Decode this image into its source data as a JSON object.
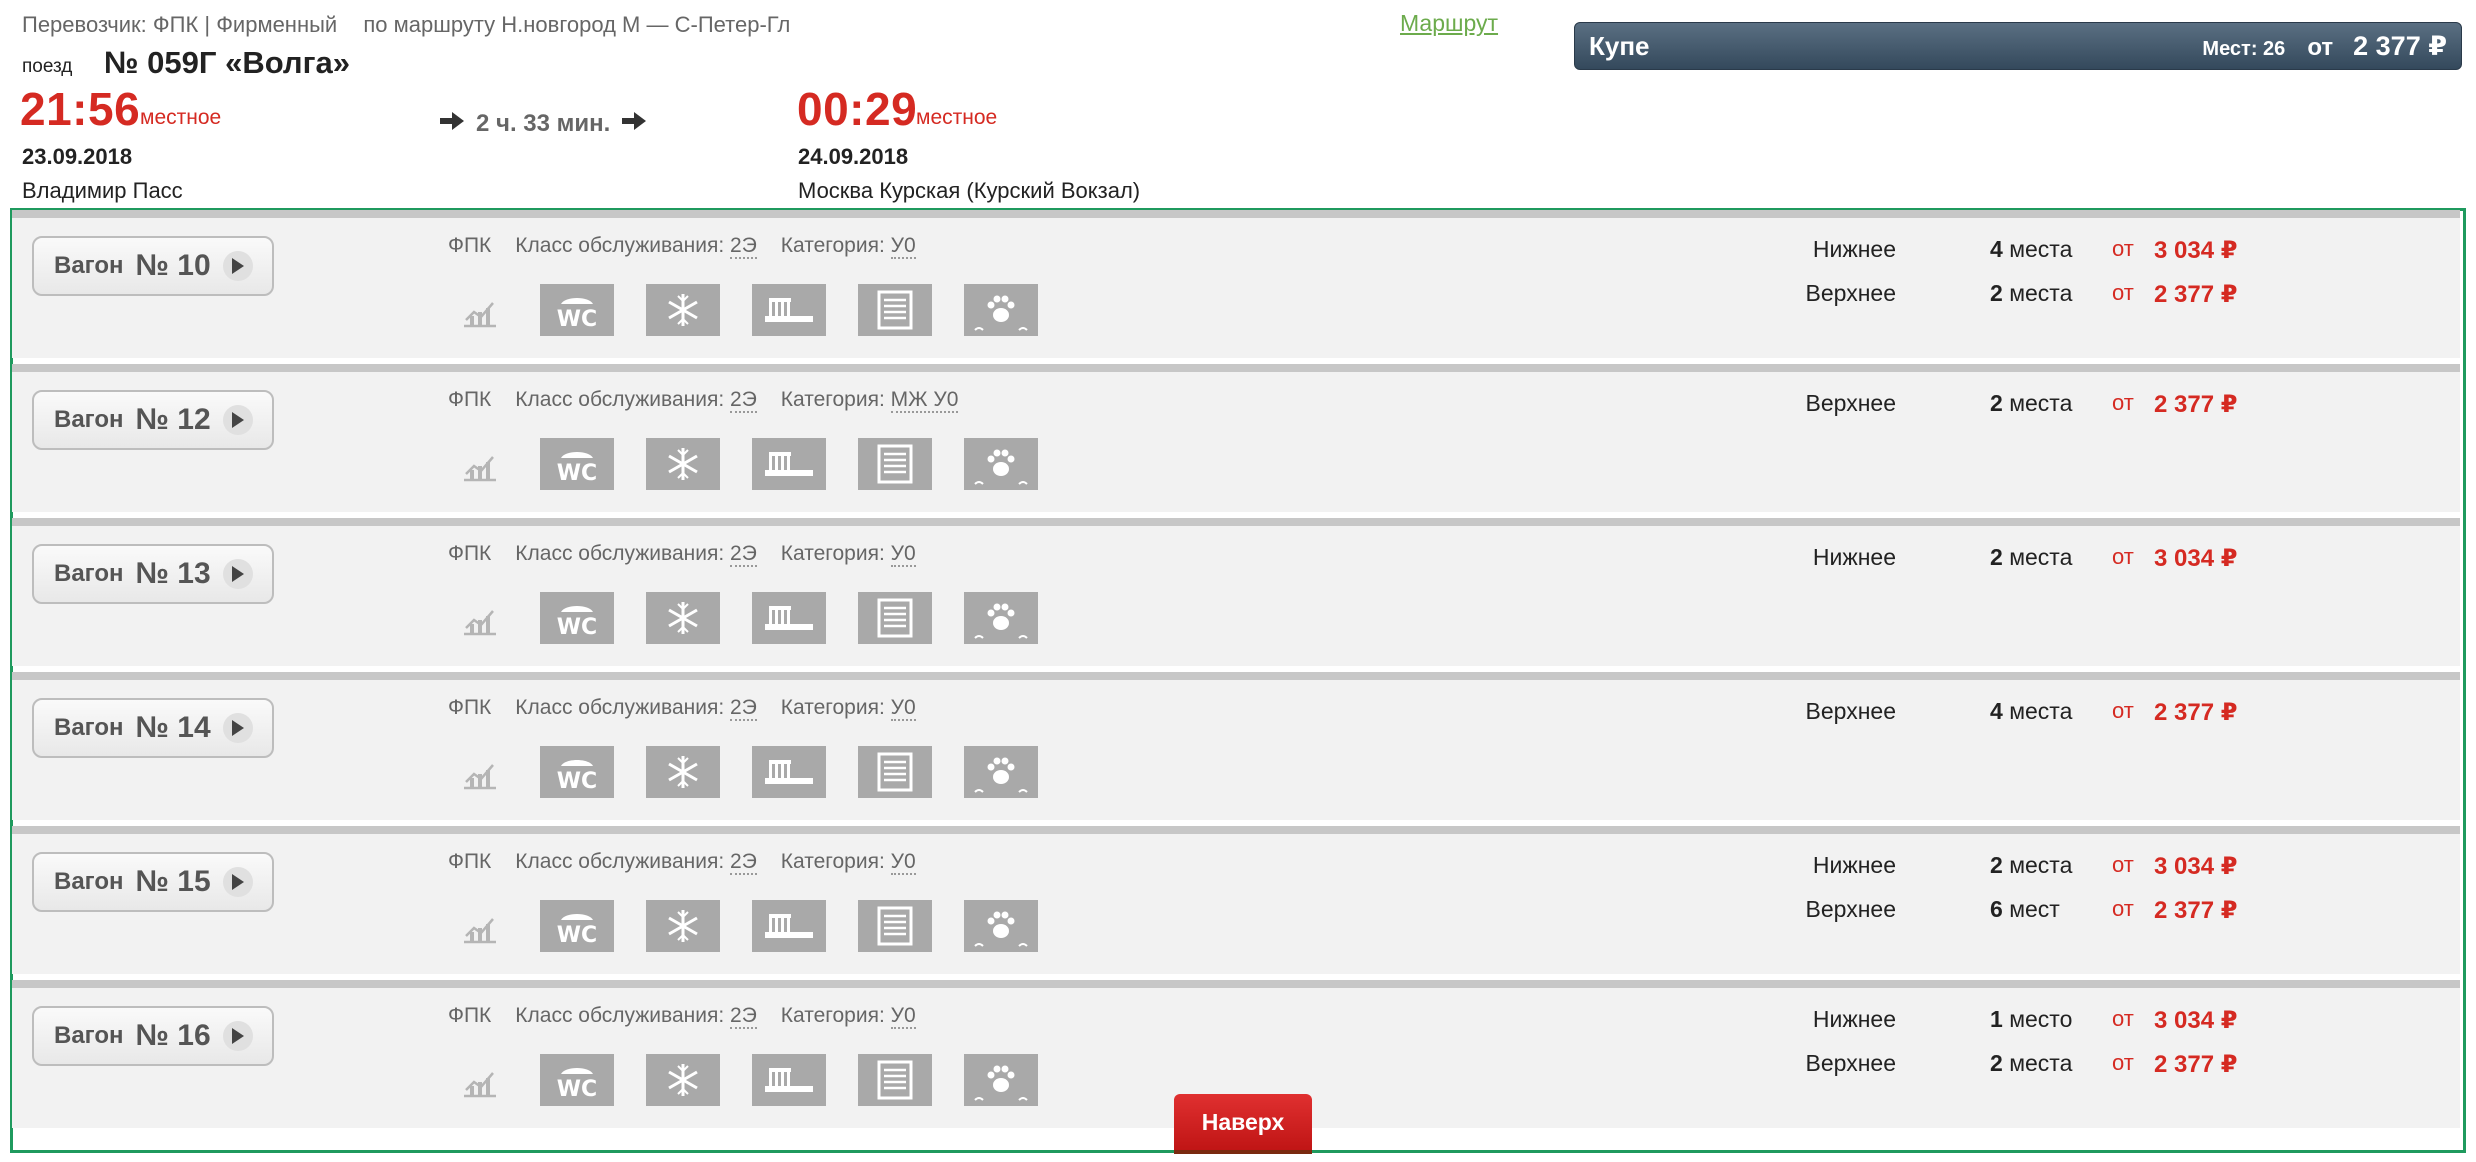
{
  "header": {
    "carrier_text": "Перевозчик: ФПК | Фирменный",
    "route_text": "по маршруту Н.новгород М — С-Петер-Гл",
    "route_link": "Маршрут",
    "train_word": "поезд",
    "train_number": "№ 059Г «Волга»",
    "departure": {
      "time": "21:56",
      "local": "местное",
      "date": "23.09.2018",
      "station": "Владимир Пасс"
    },
    "arrival": {
      "time": "00:29",
      "local": "местное",
      "date": "24.09.2018",
      "station": "Москва Курская (Курский Вокзал)"
    },
    "duration": "2 ч. 33 мин."
  },
  "class_badge": {
    "name": "Купе",
    "seats": "Мест: 26",
    "from": "от",
    "price": "2 377 ₽"
  },
  "colors": {
    "accent_red": "#d52a22",
    "panel_border": "#1f9a5e",
    "badge_bg": "#3f5366",
    "route_link": "#6cab4c"
  },
  "icon_names": [
    "chart-icon",
    "wc-icon",
    "snowflake-icon",
    "toothbrush-icon",
    "news-icon",
    "pet-icon"
  ],
  "wagons": [
    {
      "word": "Вагон",
      "number": "№ 10",
      "carrier": "ФПК",
      "class_label": "Класс обслуживания:",
      "class_value": "2Э",
      "category_label": "Категория:",
      "category_value": "У0",
      "seats": [
        {
          "type": "Нижнее",
          "count": "4",
          "unit": "места",
          "from": "от",
          "price": "3 034 ₽"
        },
        {
          "type": "Верхнее",
          "count": "2",
          "unit": "места",
          "from": "от",
          "price": "2 377 ₽"
        }
      ]
    },
    {
      "word": "Вагон",
      "number": "№ 12",
      "carrier": "ФПК",
      "class_label": "Класс обслуживания:",
      "class_value": "2Э",
      "category_label": "Категория:",
      "category_value": "МЖ У0",
      "seats": [
        {
          "type": "Верхнее",
          "count": "2",
          "unit": "места",
          "from": "от",
          "price": "2 377 ₽"
        }
      ]
    },
    {
      "word": "Вагон",
      "number": "№ 13",
      "carrier": "ФПК",
      "class_label": "Класс обслуживания:",
      "class_value": "2Э",
      "category_label": "Категория:",
      "category_value": "У0",
      "seats": [
        {
          "type": "Нижнее",
          "count": "2",
          "unit": "места",
          "from": "от",
          "price": "3 034 ₽"
        }
      ]
    },
    {
      "word": "Вагон",
      "number": "№ 14",
      "carrier": "ФПК",
      "class_label": "Класс обслуживания:",
      "class_value": "2Э",
      "category_label": "Категория:",
      "category_value": "У0",
      "seats": [
        {
          "type": "Верхнее",
          "count": "4",
          "unit": "места",
          "from": "от",
          "price": "2 377 ₽"
        }
      ]
    },
    {
      "word": "Вагон",
      "number": "№ 15",
      "carrier": "ФПК",
      "class_label": "Класс обслуживания:",
      "class_value": "2Э",
      "category_label": "Категория:",
      "category_value": "У0",
      "seats": [
        {
          "type": "Нижнее",
          "count": "2",
          "unit": "места",
          "from": "от",
          "price": "3 034 ₽"
        },
        {
          "type": "Верхнее",
          "count": "6",
          "unit": "мест",
          "from": "от",
          "price": "2 377 ₽"
        }
      ]
    },
    {
      "word": "Вагон",
      "number": "№ 16",
      "carrier": "ФПК",
      "class_label": "Класс обслуживания:",
      "class_value": "2Э",
      "category_label": "Категория:",
      "category_value": "У0",
      "seats": [
        {
          "type": "Нижнее",
          "count": "1",
          "unit": "место",
          "from": "от",
          "price": "3 034 ₽"
        },
        {
          "type": "Верхнее",
          "count": "2",
          "unit": "места",
          "from": "от",
          "price": "2 377 ₽"
        }
      ]
    }
  ],
  "top_button": "Наверх"
}
